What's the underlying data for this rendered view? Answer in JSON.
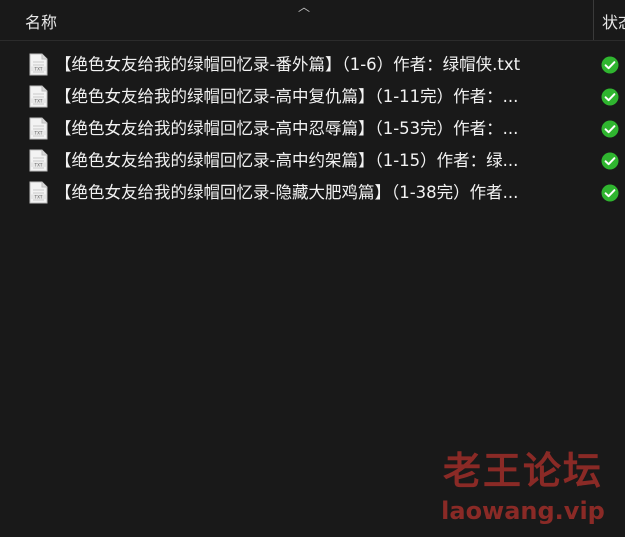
{
  "header": {
    "name_label": "名称",
    "status_label": "状态"
  },
  "files": [
    {
      "name": "【绝色女友给我的绿帽回忆录-番外篇】（1-6）作者：绿帽侠.txt",
      "icon": "txt-file-icon",
      "status": "synced"
    },
    {
      "name": "【绝色女友给我的绿帽回忆录-高中复仇篇】（1-11完）作者：...",
      "icon": "txt-file-icon",
      "status": "synced"
    },
    {
      "name": "【绝色女友给我的绿帽回忆录-高中忍辱篇】（1-53完）作者：...",
      "icon": "txt-file-icon",
      "status": "synced"
    },
    {
      "name": "【绝色女友给我的绿帽回忆录-高中约架篇】（1-15）作者：绿...",
      "icon": "txt-file-icon",
      "status": "synced"
    },
    {
      "name": "【绝色女友给我的绿帽回忆录-隐藏大肥鸡篇】（1-38完）作者...",
      "icon": "txt-file-icon",
      "status": "synced"
    }
  ],
  "watermark": {
    "title": "老王论坛",
    "domain": "laowang.vip"
  },
  "colors": {
    "background": "#191919",
    "status_green": "#2fb52f",
    "watermark": "#8a2a26"
  }
}
